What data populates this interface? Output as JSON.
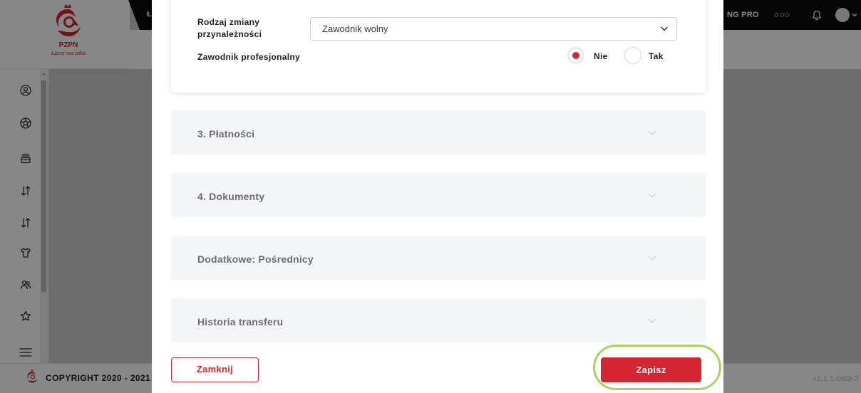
{
  "brand": {
    "name": "PZPN",
    "tagline": "Łączy nas piłka"
  },
  "header": {
    "nav_fragment": "Ł",
    "product_fragment": "NG PRO"
  },
  "sidebar": {
    "items": [
      {
        "icon": "user-circle-icon"
      },
      {
        "icon": "soccer-ball-icon"
      },
      {
        "icon": "archive-tray-icon"
      },
      {
        "icon": "sort-arrows-icon"
      },
      {
        "icon": "sort-arrows-icon"
      },
      {
        "icon": "shirt-icon"
      },
      {
        "icon": "users-icon"
      },
      {
        "icon": "star-icon"
      }
    ],
    "menu_icon": "menu-icon"
  },
  "footer": {
    "copyright": "COPYRIGHT 2020 - 2021",
    "version": "v1.1.1-beta-3"
  },
  "modal": {
    "form": {
      "change_type": {
        "label": "Rodzaj zmiany przynależności",
        "value": "Zawodnik wolny"
      },
      "professional": {
        "label": "Zawodnik profesjonalny",
        "options": [
          {
            "label": "Nie",
            "selected": true
          },
          {
            "label": "Tak",
            "selected": false
          }
        ]
      }
    },
    "sections": [
      {
        "title": "3. Płatności"
      },
      {
        "title": "4. Dokumenty"
      },
      {
        "title": "Dodatkowe: Pośrednicy"
      },
      {
        "title": "Historia transferu"
      }
    ],
    "buttons": {
      "close": "Zamknij",
      "save": "Zapisz"
    }
  },
  "colors": {
    "accent": "#d42530",
    "highlight": "#a2d65c",
    "section_bg": "#f4f5f7"
  }
}
